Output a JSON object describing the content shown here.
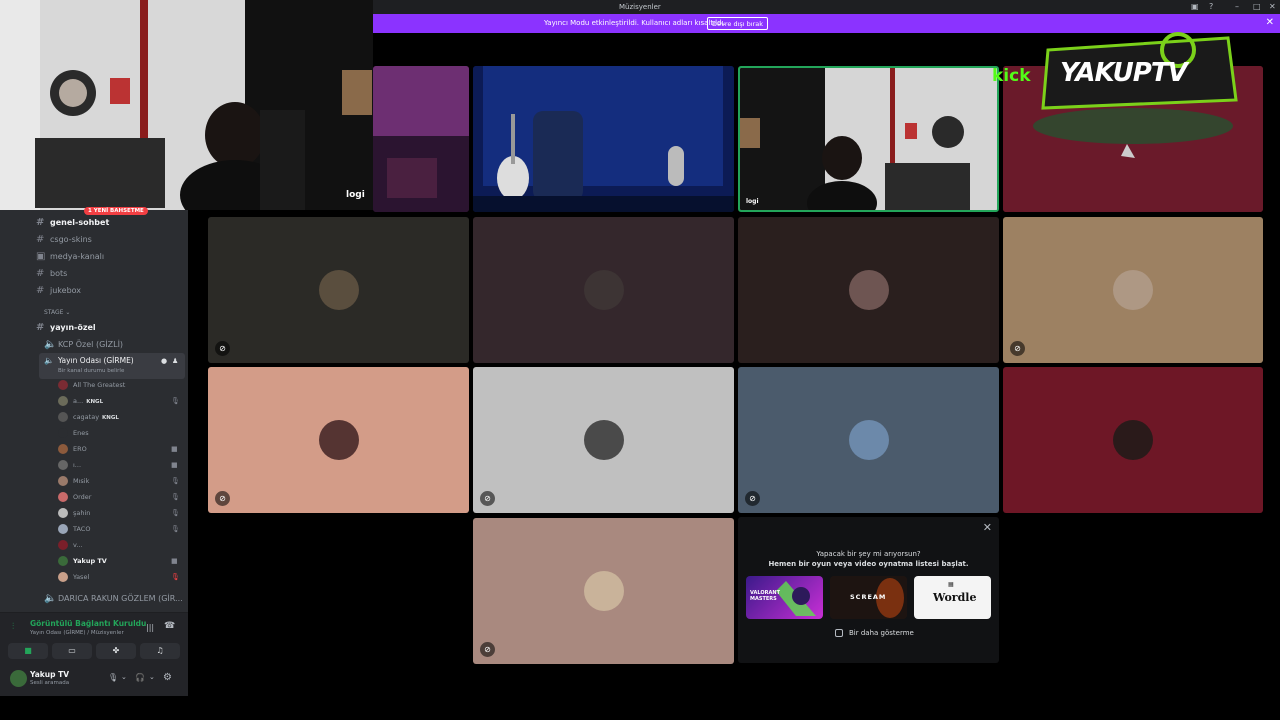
{
  "window": {
    "title": "Müzisyenler"
  },
  "banner": {
    "message": "Yayıncı Modu etkinleştirildi. Kullanıcı adları kısaltıldı.",
    "button": "Devre dışı bırak",
    "close_icon": "close-icon"
  },
  "overlay": {
    "cam_logo": "logi",
    "brand_kick": "kick",
    "brand_name": "YAKUPTV"
  },
  "sidebar": {
    "badge": "1 YENİ BAHSETME",
    "channels": [
      {
        "name": "genel-sohbet",
        "bold": true
      },
      {
        "name": "csgo-skins"
      },
      {
        "name": "medya-kanalı"
      },
      {
        "name": "bots"
      },
      {
        "name": "jukebox"
      }
    ],
    "category_stage": "STAGE",
    "stage_channel": "yayın-özel",
    "voice_channel_1": "KCP Özel (GİZLİ)",
    "voice_active": {
      "name": "Yayın Odası (GİRME)",
      "status": "Bir kanal durumu belirle"
    },
    "users": [
      {
        "name": "All The Greatest",
        "color": "#7a2b33"
      },
      {
        "name": "a...",
        "tag": "KNGL",
        "color": "#6b6b5a"
      },
      {
        "name": "cagatay",
        "tag": "KNGL",
        "color": "#555"
      },
      {
        "name": "Enes",
        "color": "#2b2d31"
      },
      {
        "name": "ERO",
        "color": "#8c5a3c"
      },
      {
        "name": "ı...",
        "color": "#666"
      },
      {
        "name": "Mısik",
        "color": "#9a7a6a"
      },
      {
        "name": "Order",
        "color": "#c96a6a"
      },
      {
        "name": "şahin",
        "color": "#bbbbbb"
      },
      {
        "name": "TACO",
        "color": "#9aa6b8"
      },
      {
        "name": "v...",
        "color": "#7a1f2a"
      },
      {
        "name": "Yakup TV",
        "color": "#3a6a3a"
      },
      {
        "name": "Yasel",
        "color": "#c9a08a"
      }
    ],
    "voice_channel_2": "DARICA RAKUN GÖZLEM (GİR..."
  },
  "voice_panel": {
    "status": "Görüntülü Bağlantı Kuruldu",
    "location": "Yayın Odası (GİRME) / Müzisyenler",
    "user": "Yakup TV",
    "user_status": "Sesli aramada"
  },
  "tiles": [
    {
      "bg": "#2b2a26",
      "avatar": "#5a4e3e"
    },
    {
      "bg": "#34272c",
      "avatar": "#3d3434"
    },
    {
      "bg": "#2a1f1e",
      "avatar": "#6e5552"
    },
    {
      "bg": "#9d8162",
      "avatar": "#ae9884"
    },
    {
      "bg": "#d39c88",
      "avatar": "#553432"
    },
    {
      "bg": "#c0c0c0",
      "avatar": "#4a4a4a"
    },
    {
      "bg": "#4b5b6c",
      "avatar": "#6c89aa"
    },
    {
      "bg": "#6e1726",
      "avatar": "#2a1a1a"
    },
    {
      "bg": "#a9897f",
      "avatar": "#c9b39a"
    }
  ],
  "activity": {
    "headline": "Yapacak bir şey mi arıyorsun?",
    "subline": "Hemen bir oyun veya video oynatma listesi başlat.",
    "games": [
      {
        "label": "VALORANT MASTERS",
        "bg": "#6a2ad4"
      },
      {
        "label": "SCREAM",
        "bg": "#231c18"
      },
      {
        "label": "Wordle",
        "bg": "#f4f4f4"
      }
    ],
    "checkbox_label": "Bir daha gösterme"
  }
}
